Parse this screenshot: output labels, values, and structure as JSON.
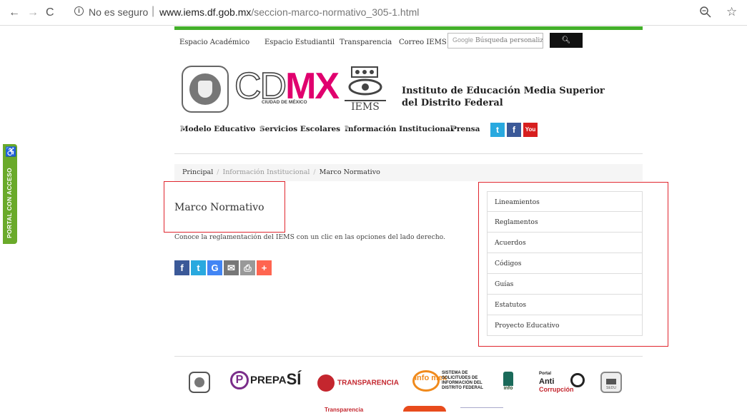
{
  "browser": {
    "security_label": "No es seguro",
    "url_host": "www.iems.df.gob.mx",
    "url_path": "/seccion-marco-normativo_305-1.html"
  },
  "accessibility": {
    "label": "PORTAL CON ACCESO"
  },
  "topnav": {
    "items": [
      "Espacio Académico",
      "Espacio Estudiantil",
      "Transparencia",
      "Correo IEMS"
    ],
    "search_placeholder": "Búsqueda personaliz",
    "search_brand": "Google"
  },
  "header": {
    "cdmx_cd": "CD",
    "cdmx_mx": "MX",
    "cdmx_sub": "CIUDAD DE MÉXICO",
    "iems_logo_text": "IEMS",
    "institute_line1": "Instituto de Educación Media Superior",
    "institute_line2": "del Distrito Federal"
  },
  "mainnav": {
    "items": [
      "Modelo Educativo",
      "Servicios Escolares",
      "Información Institucional",
      "Prensa"
    ]
  },
  "social": {
    "twitter": "t",
    "facebook": "f",
    "youtube": "You"
  },
  "breadcrumb": {
    "home": "Principal",
    "section": "Información Institucional",
    "current": "Marco Normativo"
  },
  "content": {
    "title": "Marco Normativo",
    "description": "Conoce la reglamentación del IEMS con un clic en las opciones del lado derecho."
  },
  "share": {
    "buttons": [
      {
        "icon": "facebook-icon",
        "glyph": "f",
        "color": "#3b5998"
      },
      {
        "icon": "twitter-icon",
        "glyph": "t",
        "color": "#29a9df"
      },
      {
        "icon": "google-icon",
        "glyph": "G",
        "color": "#4285f4"
      },
      {
        "icon": "email-icon",
        "glyph": "✉",
        "color": "#777777"
      },
      {
        "icon": "print-icon",
        "glyph": "⎙",
        "color": "#999999"
      },
      {
        "icon": "plus-icon",
        "glyph": "+",
        "color": "#ff6550"
      }
    ]
  },
  "sidebar": {
    "items": [
      "Lineamientos",
      "Reglamentos",
      "Acuerdos",
      "Códigos",
      "Guías",
      "Estatutos",
      "Proyecto Educativo"
    ]
  },
  "footer": {
    "prepa_text": "PREPA",
    "prepa_si": "SÍ",
    "transparencia": "TRANSPARENCIA",
    "infomex_logo": "info mex",
    "infomex_text": "SISTEMA DE SOLICITUDES DE INFORMACIÓN DEL DISTRITO FEDERAL",
    "infodf": "info",
    "anti_portal": "Portal",
    "anti_main": "Anti",
    "anti_sub": "Corrupción",
    "sedu": "SEDU",
    "partial_transparencia": "Transparencia"
  },
  "colors": {
    "brand_green": "#43b02a",
    "cdmx_pink": "#e0006e",
    "highlight_red": "#e0262e"
  }
}
